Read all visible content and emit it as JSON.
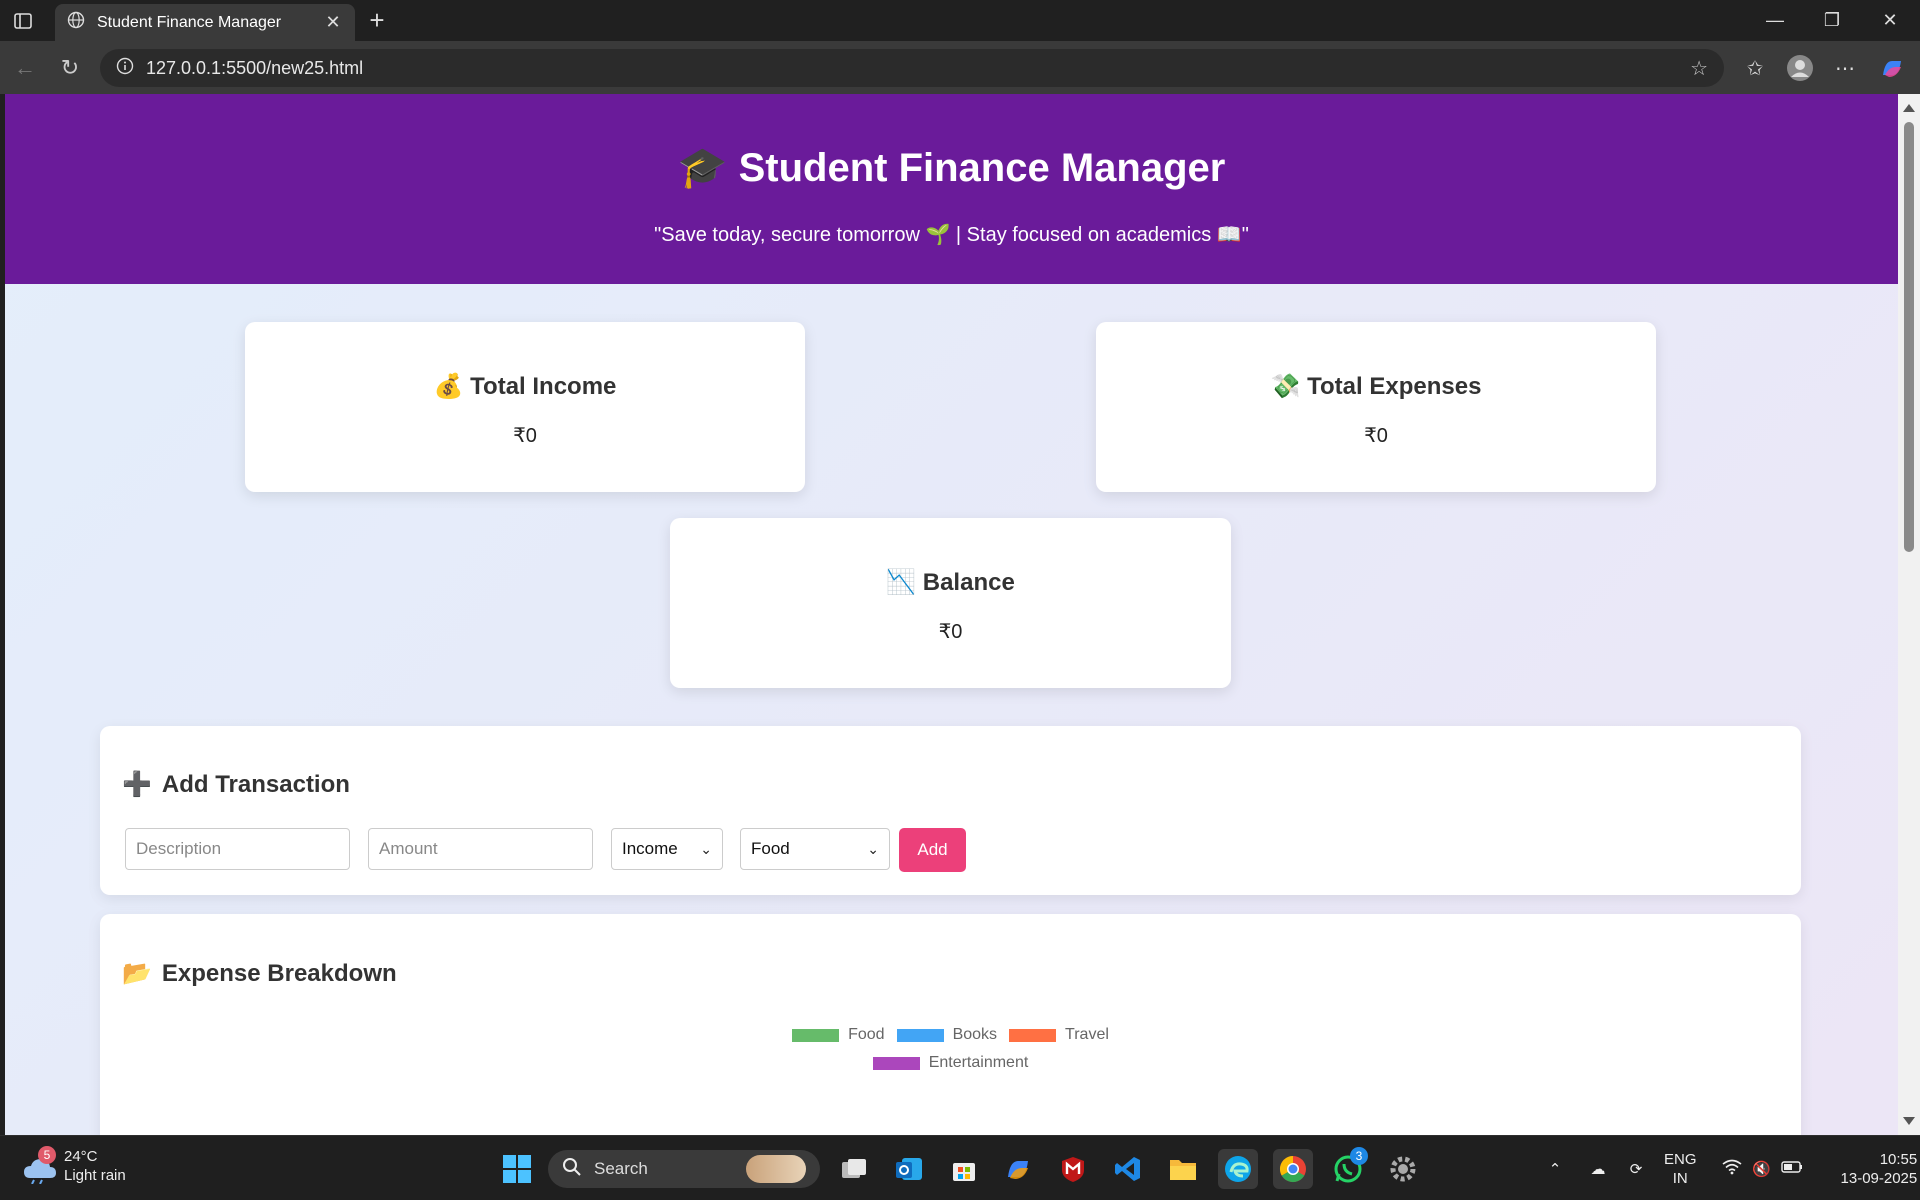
{
  "browser": {
    "tab_title": "Student Finance Manager",
    "url": "127.0.0.1:5500/new25.html"
  },
  "page": {
    "header": {
      "title_icon": "🎓",
      "title": "Student Finance Manager",
      "tagline": "\"Save today, secure tomorrow 🌱 | Stay focused on academics 📖\""
    },
    "cards": {
      "income": {
        "icon": "💰",
        "title": "Total Income",
        "value": "₹0"
      },
      "expenses": {
        "icon": "💸",
        "title": "Total Expenses",
        "value": "₹0"
      },
      "balance": {
        "icon": "📉",
        "title": "Balance",
        "value": "₹0"
      }
    },
    "add_transaction": {
      "icon": "➕",
      "title": "Add Transaction",
      "description_placeholder": "Description",
      "amount_placeholder": "Amount",
      "type_selected": "Income",
      "category_selected": "Food",
      "add_label": "Add"
    },
    "expense_breakdown": {
      "icon": "📂",
      "title": "Expense Breakdown",
      "legend": [
        {
          "label": "Food",
          "color": "#66bb6a"
        },
        {
          "label": "Books",
          "color": "#42a5f5"
        },
        {
          "label": "Travel",
          "color": "#ff7043"
        },
        {
          "label": "Entertainment",
          "color": "#ab47bc"
        }
      ]
    }
  },
  "taskbar": {
    "weather": {
      "temp": "24°C",
      "condition": "Light rain",
      "badge": "5"
    },
    "search_label": "Search",
    "whatsapp_badge": "3",
    "language": "ENG",
    "region": "IN",
    "time": "10:55",
    "date": "13-09-2025"
  },
  "colors": {
    "header_purple": "#6a1b9a",
    "add_button_pink": "#ec407a"
  }
}
